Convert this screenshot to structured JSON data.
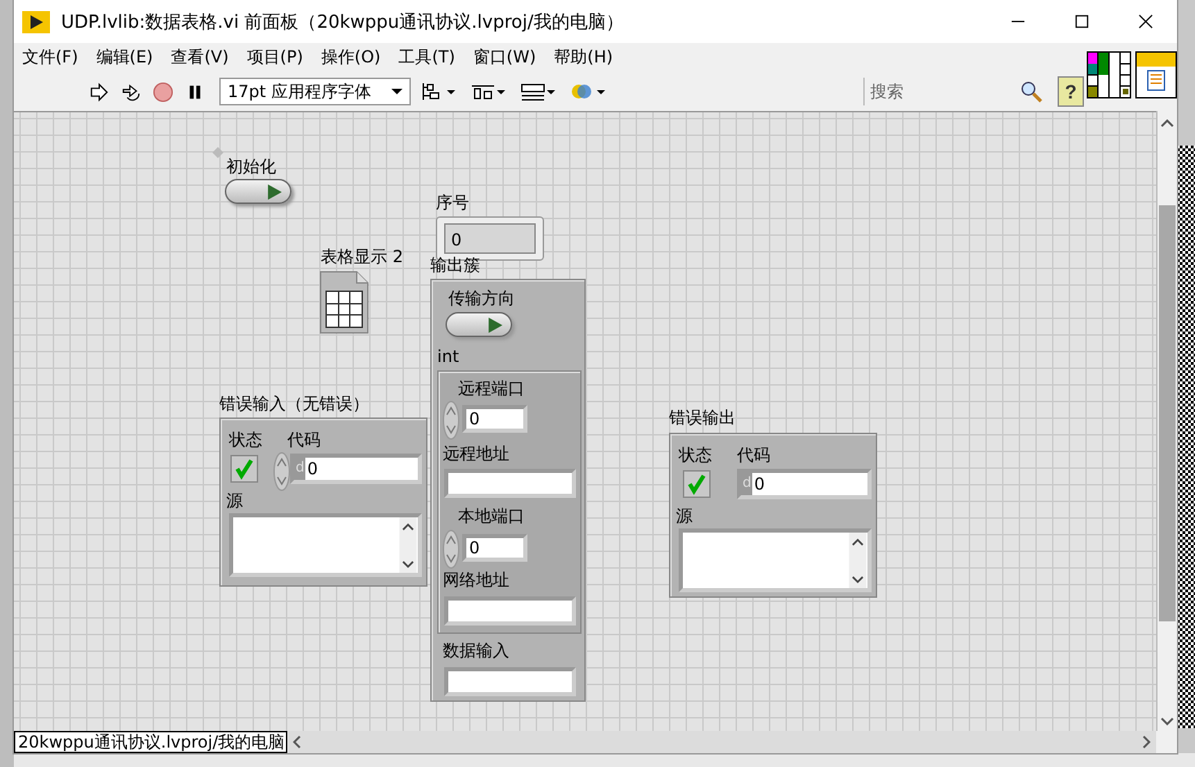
{
  "window": {
    "title": "UDP.lvlib:数据表格.vi 前面板（20kwppu通讯协议.lvproj/我的电脑）"
  },
  "menu": [
    {
      "label": "文件(F)"
    },
    {
      "label": "编辑(E)"
    },
    {
      "label": "查看(V)"
    },
    {
      "label": "项目(P)"
    },
    {
      "label": "操作(O)"
    },
    {
      "label": "工具(T)"
    },
    {
      "label": "窗口(W)"
    },
    {
      "label": "帮助(H)"
    }
  ],
  "toolbar": {
    "font": "17pt 应用程序字体",
    "search": {
      "placeholder": "搜索"
    },
    "help": "?"
  },
  "init_switch": {
    "label": "初始化",
    "on": false
  },
  "index_indicator": {
    "label": "序号",
    "value": "0"
  },
  "table": {
    "label": "表格显示 2"
  },
  "output_cluster": {
    "label": "输出簇",
    "direction": {
      "label": "传输方向",
      "on": false
    },
    "int_label": "int",
    "remote_port": {
      "label": "远程端口",
      "value": "0"
    },
    "remote_address": {
      "label": "远程地址"
    },
    "local_port": {
      "label": "本地端口",
      "value": "0"
    },
    "net_address": {
      "label": "网络地址"
    },
    "data_in": {
      "label": "数据输入"
    }
  },
  "error_in": {
    "label": "错误输入（无错误）",
    "status_label": "状态",
    "code_label": "代码",
    "status": false,
    "radix": "d",
    "code": "0",
    "source_label": "源"
  },
  "error_out": {
    "label": "错误输出",
    "status_label": "状态",
    "code_label": "代码",
    "status": false,
    "radix": "d",
    "code": "0",
    "source_label": "源"
  },
  "status_bar": {
    "path": "20kwppu通讯协议.lvproj/我的电脑"
  }
}
